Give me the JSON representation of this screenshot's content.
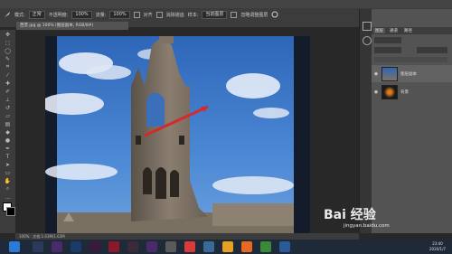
{
  "options_bar": {
    "mode_label": "模式:",
    "mode_value": "正常",
    "opacity_label": "不透明度:",
    "opacity_value": "100%",
    "flow_label": "流量:",
    "flow_value": "100%",
    "checkbox1_label": "对齐",
    "checkbox2_label": "消除锯齿",
    "sample_label": "样本:",
    "sample_value": "当前图层",
    "ignore_label": "忽略调整图层"
  },
  "document_tab": {
    "title": "西堡.jpg @ 100% (图层副本, RGB/8#)"
  },
  "layers_panel": {
    "tabs": [
      "图层",
      "通道",
      "路径"
    ],
    "active_tab": "图层",
    "layers": [
      {
        "name": "图层副本"
      },
      {
        "name": "背景"
      }
    ]
  },
  "status_bar": {
    "zoom": "100%",
    "doc_info": "文档:1.63M/1.63M"
  },
  "watermark": {
    "logo": "Bai 经验",
    "url": "jingyan.baidu.com"
  },
  "taskbar": {
    "time": "23:40",
    "date": "2020/1/7"
  },
  "colors": {
    "ps_dark": "#3c3c3c",
    "panel": "#535353",
    "arrow": "#d42a2a",
    "sky": "#3a78c8"
  }
}
